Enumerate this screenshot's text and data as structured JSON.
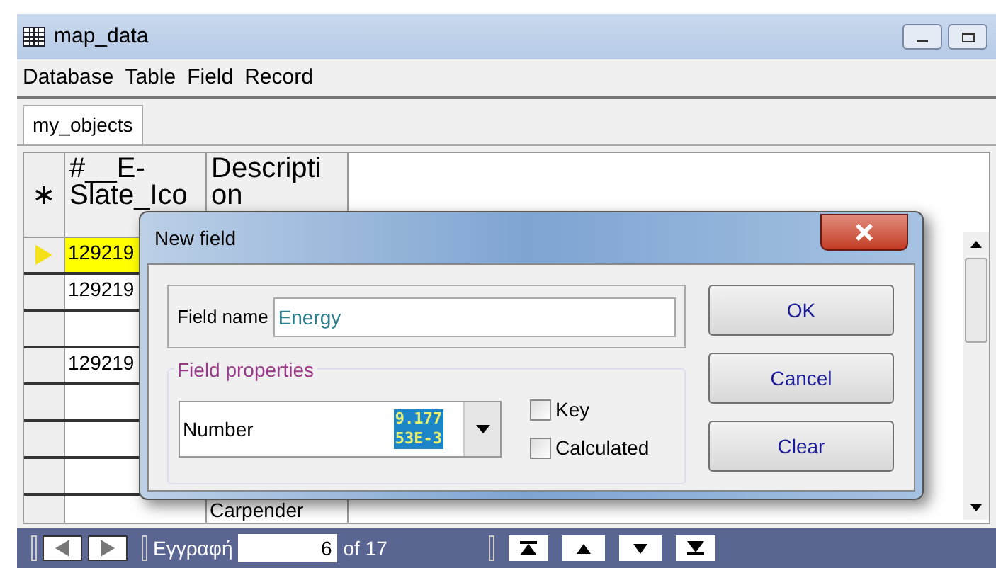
{
  "window": {
    "title": "map_data"
  },
  "menu": [
    "Database",
    "Table",
    "Field",
    "Record"
  ],
  "tabs": [
    {
      "label": "my_objects",
      "selected": true
    }
  ],
  "table": {
    "corner": "∗",
    "columns": [
      "#__E-Slate_Ico",
      "Descripti on"
    ],
    "rows": [
      {
        "cells": [
          "129219",
          ""
        ],
        "selected": true
      },
      {
        "cells": [
          "129219",
          ""
        ],
        "selected": false
      },
      {
        "cells": [
          "",
          ""
        ],
        "selected": false
      },
      {
        "cells": [
          "129219",
          ""
        ],
        "selected": false
      },
      {
        "cells": [
          "",
          ""
        ],
        "selected": false
      },
      {
        "cells": [
          "",
          ""
        ],
        "selected": false
      },
      {
        "cells": [
          "",
          ""
        ],
        "selected": false
      },
      {
        "cells": [
          "",
          "Carpender"
        ],
        "selected": false
      }
    ]
  },
  "dialog": {
    "title": "New field",
    "field_name_label": "Field name",
    "field_name_value": "Energy",
    "group_title": "Field properties",
    "type_value": "Number",
    "overlay_lines": [
      "9.177",
      "53E-3"
    ],
    "checkboxes": [
      {
        "label": "Key",
        "checked": false
      },
      {
        "label": "Calculated",
        "checked": false
      }
    ],
    "buttons": [
      "OK",
      "Cancel",
      "Clear"
    ]
  },
  "navigator": {
    "label": "Εγγραφή",
    "value": "6",
    "total": "of 17"
  }
}
